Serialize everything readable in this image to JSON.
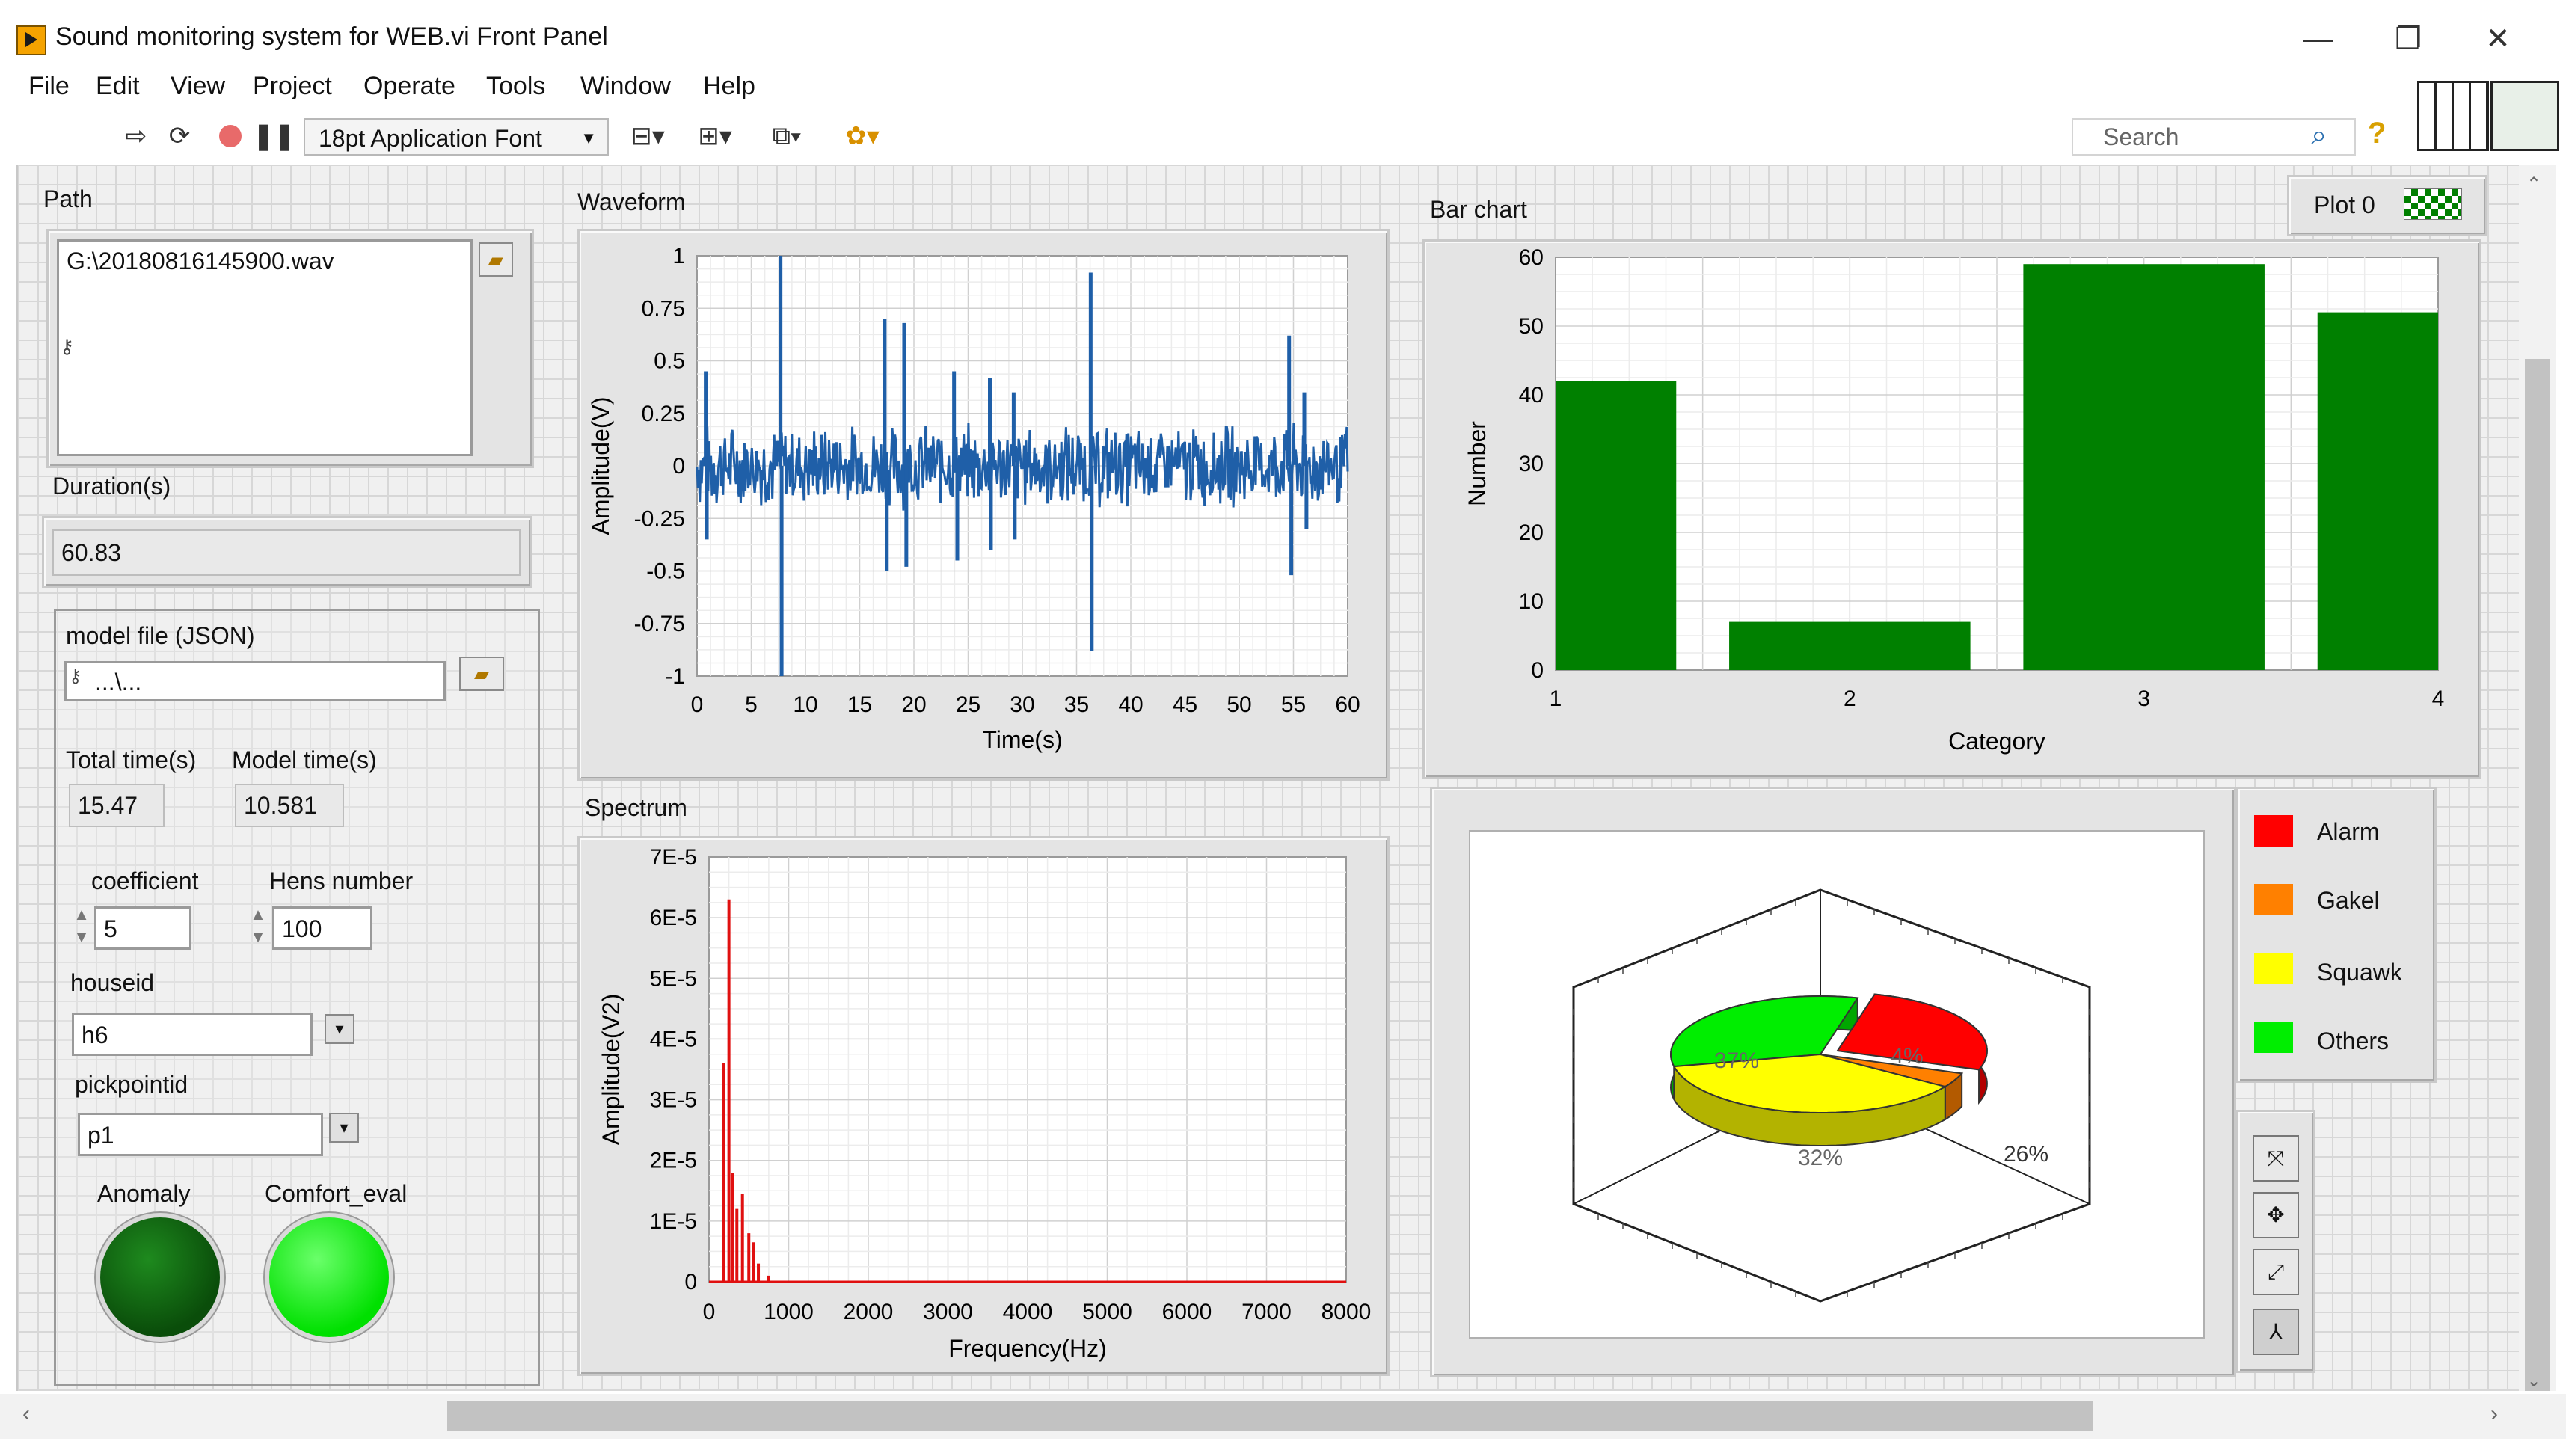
{
  "window": {
    "title": "Sound monitoring system for WEB.vi Front Panel",
    "controls": {
      "minimize": "—",
      "restore": "❐",
      "close": "✕"
    }
  },
  "menu": [
    "File",
    "Edit",
    "View",
    "Project",
    "Operate",
    "Tools",
    "Window",
    "Help"
  ],
  "toolbar": {
    "font": "18pt Application Font",
    "search_placeholder": "Search",
    "icons": [
      "run-arrow-icon",
      "run-continuously-icon",
      "abort-icon",
      "pause-icon",
      "align-icon",
      "distribute-icon",
      "resize-icon",
      "reorder-icon"
    ]
  },
  "left_panel": {
    "path_label": "Path",
    "path_value": "G:\\20180816145900.wav",
    "duration_label": "Duration(s)",
    "duration_value": "60.83",
    "model_file_label": "model file (JSON)",
    "model_file_value": "...\\...",
    "total_time_label": "Total time(s)",
    "total_time_value": "15.47",
    "model_time_label": "Model time(s)",
    "model_time_value": "10.581",
    "coefficient_label": "coefficient",
    "coefficient_value": "5",
    "hens_label": "Hens number",
    "hens_value": "100",
    "houseid_label": "houseid",
    "houseid_value": "h6",
    "pickpointid_label": "pickpointid",
    "pickpointid_value": "p1",
    "anomaly_label": "Anomaly",
    "comfort_label": "Comfort_eval",
    "anomaly_color": "#0a5a0a",
    "comfort_color": "#00ee00"
  },
  "chart_data": [
    {
      "id": "waveform",
      "type": "line",
      "title": "Waveform",
      "xlabel": "Time(s)",
      "ylabel": "Amplitude(V)",
      "xlim": [
        0,
        60
      ],
      "ylim": [
        -1,
        1
      ],
      "xticks": [
        0,
        5,
        10,
        15,
        20,
        25,
        30,
        35,
        40,
        45,
        50,
        55,
        60
      ],
      "yticks": [
        1,
        0.75,
        0.5,
        0.25,
        0,
        -0.25,
        -0.5,
        -0.75,
        -1
      ],
      "ytick_labels": [
        "1",
        "0.75",
        "0.5",
        "0.25",
        "0",
        "-0.25",
        "-0.5",
        "-0.75",
        "-1"
      ],
      "color": "#1f5fa8",
      "noise_band": [
        -0.18,
        0.18
      ],
      "spikes": [
        {
          "x": 0.8,
          "y": 0.45
        },
        {
          "x": 0.9,
          "y": -0.35
        },
        {
          "x": 7.7,
          "y": 1.0
        },
        {
          "x": 7.8,
          "y": -1.0
        },
        {
          "x": 17.3,
          "y": 0.7
        },
        {
          "x": 17.5,
          "y": -0.5
        },
        {
          "x": 19.1,
          "y": 0.68
        },
        {
          "x": 19.3,
          "y": -0.48
        },
        {
          "x": 23.7,
          "y": 0.45
        },
        {
          "x": 24.0,
          "y": -0.45
        },
        {
          "x": 27.0,
          "y": 0.42
        },
        {
          "x": 27.1,
          "y": -0.4
        },
        {
          "x": 29.2,
          "y": 0.35
        },
        {
          "x": 29.3,
          "y": -0.35
        },
        {
          "x": 36.3,
          "y": 0.92
        },
        {
          "x": 36.4,
          "y": -0.88
        },
        {
          "x": 54.6,
          "y": 0.62
        },
        {
          "x": 54.8,
          "y": -0.52
        },
        {
          "x": 56.0,
          "y": 0.35
        },
        {
          "x": 56.2,
          "y": -0.3
        }
      ]
    },
    {
      "id": "spectrum",
      "type": "line",
      "title": "Spectrum",
      "xlabel": "Frequency(Hz)",
      "ylabel": "Amplitude(V2)",
      "xlim": [
        0,
        8000
      ],
      "ylim": [
        0,
        7e-05
      ],
      "xticks": [
        0,
        1000,
        2000,
        3000,
        4000,
        5000,
        6000,
        7000,
        8000
      ],
      "yticks": [
        7e-05,
        6e-05,
        5e-05,
        4e-05,
        3e-05,
        2e-05,
        1e-05,
        0
      ],
      "ytick_labels": [
        "7E-5",
        "6E-5",
        "5E-5",
        "4E-5",
        "3E-5",
        "2E-5",
        "1E-5",
        "0"
      ],
      "color": "#e01010",
      "peaks": [
        {
          "x": 180,
          "y": 3.6e-05
        },
        {
          "x": 250,
          "y": 6.3e-05
        },
        {
          "x": 300,
          "y": 1.8e-05
        },
        {
          "x": 350,
          "y": 1.2e-05
        },
        {
          "x": 420,
          "y": 1.45e-05
        },
        {
          "x": 500,
          "y": 8e-06
        },
        {
          "x": 560,
          "y": 6.5e-06
        },
        {
          "x": 620,
          "y": 3e-06
        },
        {
          "x": 750,
          "y": 1e-06
        }
      ]
    },
    {
      "id": "bar",
      "type": "bar",
      "title": "Bar chart",
      "xlabel": "Category",
      "ylabel": "Number",
      "categories": [
        "1",
        "2",
        "3",
        "4"
      ],
      "values": [
        42,
        7,
        59,
        52
      ],
      "ylim": [
        0,
        60
      ],
      "yticks": [
        60,
        50,
        40,
        30,
        20,
        10,
        0
      ],
      "color": "#008000",
      "legend": "Plot 0"
    },
    {
      "id": "pie",
      "type": "pie",
      "labels": [
        "Alarm",
        "Gakel",
        "Squawk",
        "Others"
      ],
      "values": [
        26,
        4,
        37,
        32
      ],
      "value_labels": [
        "26%",
        "4%",
        "37%",
        "32%"
      ],
      "colors": [
        "#ff0000",
        "#ff8000",
        "#ffff00",
        "#00ee00"
      ]
    }
  ]
}
